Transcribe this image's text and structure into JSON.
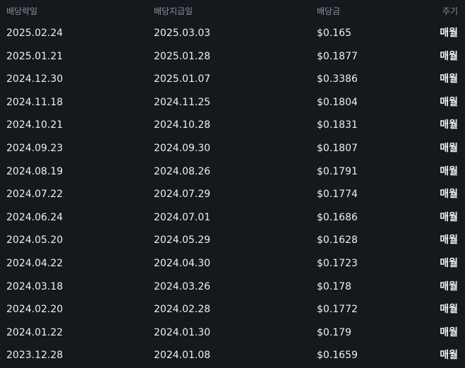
{
  "table": {
    "headers": {
      "ex_date": "배당락일",
      "pay_date": "배당지급일",
      "amount": "배당금",
      "frequency": "주기"
    },
    "rows": [
      {
        "ex_date": "2025.02.24",
        "pay_date": "2025.03.03",
        "amount": "$0.165",
        "frequency": "매월"
      },
      {
        "ex_date": "2025.01.21",
        "pay_date": "2025.01.28",
        "amount": "$0.1877",
        "frequency": "매월"
      },
      {
        "ex_date": "2024.12.30",
        "pay_date": "2025.01.07",
        "amount": "$0.3386",
        "frequency": "매월"
      },
      {
        "ex_date": "2024.11.18",
        "pay_date": "2024.11.25",
        "amount": "$0.1804",
        "frequency": "매월"
      },
      {
        "ex_date": "2024.10.21",
        "pay_date": "2024.10.28",
        "amount": "$0.1831",
        "frequency": "매월"
      },
      {
        "ex_date": "2024.09.23",
        "pay_date": "2024.09.30",
        "amount": "$0.1807",
        "frequency": "매월"
      },
      {
        "ex_date": "2024.08.19",
        "pay_date": "2024.08.26",
        "amount": "$0.1791",
        "frequency": "매월"
      },
      {
        "ex_date": "2024.07.22",
        "pay_date": "2024.07.29",
        "amount": "$0.1774",
        "frequency": "매월"
      },
      {
        "ex_date": "2024.06.24",
        "pay_date": "2024.07.01",
        "amount": "$0.1686",
        "frequency": "매월"
      },
      {
        "ex_date": "2024.05.20",
        "pay_date": "2024.05.29",
        "amount": "$0.1628",
        "frequency": "매월"
      },
      {
        "ex_date": "2024.04.22",
        "pay_date": "2024.04.30",
        "amount": "$0.1723",
        "frequency": "매월"
      },
      {
        "ex_date": "2024.03.18",
        "pay_date": "2024.03.26",
        "amount": "$0.178",
        "frequency": "매월"
      },
      {
        "ex_date": "2024.02.20",
        "pay_date": "2024.02.28",
        "amount": "$0.1772",
        "frequency": "매월"
      },
      {
        "ex_date": "2024.01.22",
        "pay_date": "2024.01.30",
        "amount": "$0.179",
        "frequency": "매월"
      },
      {
        "ex_date": "2023.12.28",
        "pay_date": "2024.01.08",
        "amount": "$0.1659",
        "frequency": "매월"
      }
    ]
  }
}
